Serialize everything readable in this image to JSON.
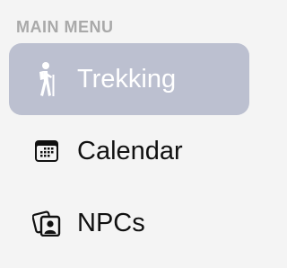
{
  "sidebar": {
    "section_title": "MAIN MENU",
    "items": [
      {
        "label": "Trekking",
        "icon": "hiking-person-icon",
        "selected": true
      },
      {
        "label": "Calendar",
        "icon": "calendar-icon",
        "selected": false
      },
      {
        "label": "NPCs",
        "icon": "people-portraits-icon",
        "selected": false
      }
    ]
  },
  "colors": {
    "background": "#f4f4f4",
    "selected_background": "#bcc0d0",
    "section_title": "#a9a9a9",
    "text": "#111111",
    "selected_text": "#ffffff"
  }
}
